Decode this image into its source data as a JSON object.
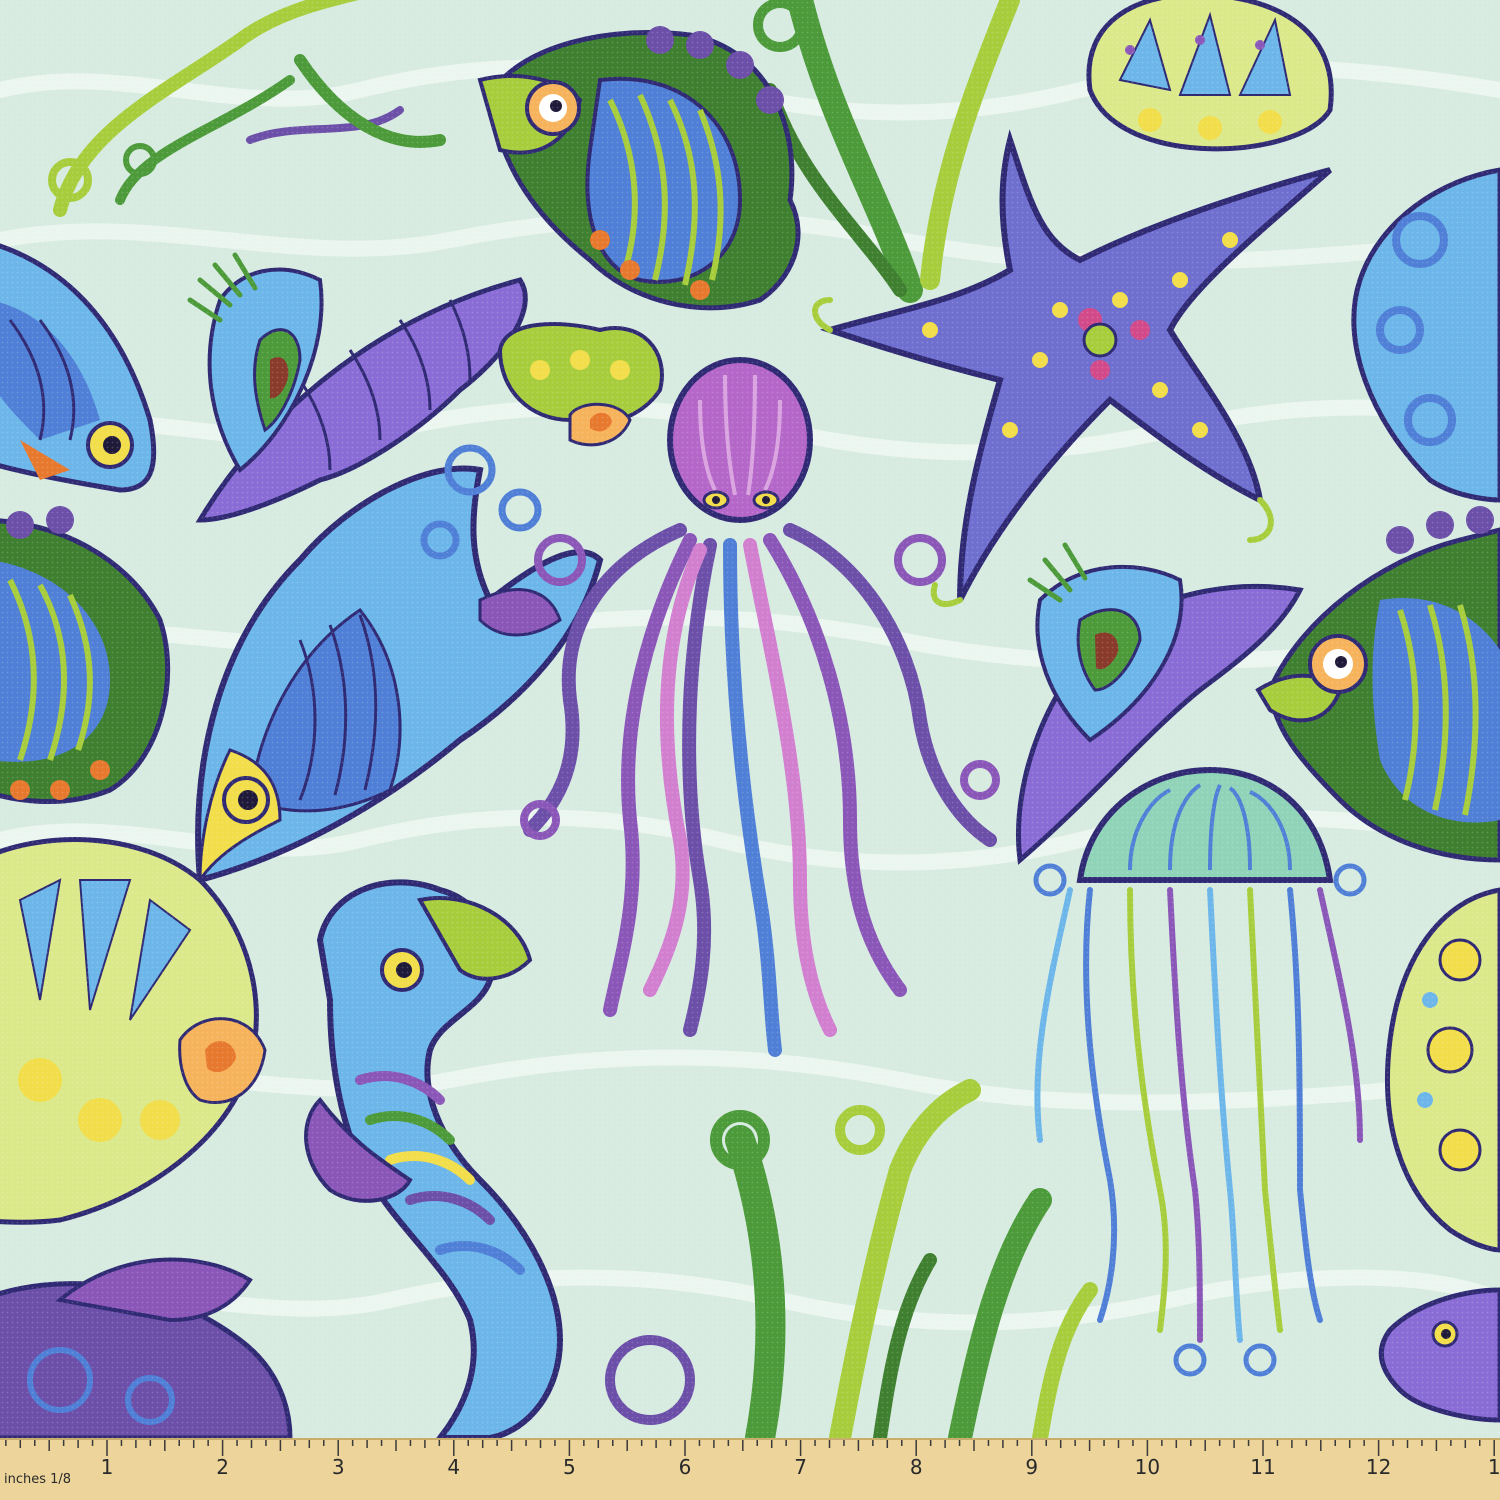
{
  "fabric": {
    "background_color": "#d7ebe1",
    "wave_color": "#eef7f2",
    "palette": {
      "purple": "#6b4fa8",
      "violet": "#8a56b8",
      "blue": "#4f7fd6",
      "sky": "#6cb6ea",
      "green": "#4c9a3a",
      "lime": "#a7cd3c",
      "yellow": "#f2dd4a",
      "orange": "#e7792e",
      "pink": "#d27fd0",
      "outline": "#2f2a73"
    },
    "motifs": [
      "tropical-fish",
      "angelfish",
      "octopus",
      "starfish",
      "jellyfish",
      "seahorse",
      "seashell",
      "scallop-shell",
      "conch-shell",
      "seaweed"
    ]
  },
  "ruler": {
    "caption": "inches 1/8",
    "numbers": [
      "1",
      "2",
      "3",
      "4",
      "5",
      "6",
      "7",
      "8",
      "9",
      "10",
      "11",
      "12",
      "1"
    ],
    "color": "#ecd49a"
  }
}
